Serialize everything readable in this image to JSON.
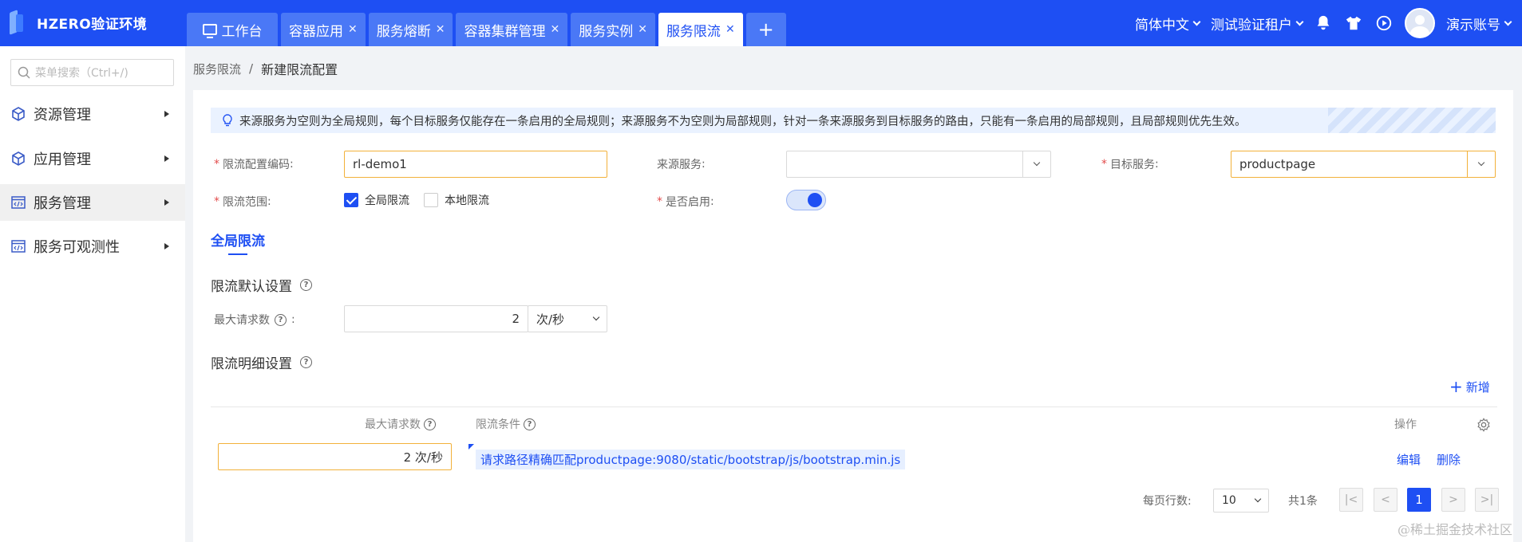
{
  "app": {
    "title": "HZERO验证环境"
  },
  "tabs": [
    {
      "label": "工作台",
      "closable": false
    },
    {
      "label": "容器应用",
      "closable": true
    },
    {
      "label": "服务熔断",
      "closable": true
    },
    {
      "label": "容器集群管理",
      "closable": true
    },
    {
      "label": "服务实例",
      "closable": true
    },
    {
      "label": "服务限流",
      "closable": true,
      "active": true
    }
  ],
  "topbar": {
    "language": "简体中文",
    "tenant": "测试验证租户",
    "account": "演示账号"
  },
  "sidebar": {
    "search_placeholder": "菜单搜索（Ctrl+/)",
    "items": [
      {
        "label": "资源管理",
        "icon": "cube-icon"
      },
      {
        "label": "应用管理",
        "icon": "cube-icon"
      },
      {
        "label": "服务管理",
        "icon": "code-window-icon",
        "active": true
      },
      {
        "label": "服务可观测性",
        "icon": "code-window-icon"
      }
    ]
  },
  "breadcrumb": {
    "parent": "服务限流",
    "separator": "/",
    "current": "新建限流配置"
  },
  "info_text": "来源服务为空则为全局规则，每个目标服务仅能存在一条启用的全局规则；来源服务不为空则为局部规则，针对一条来源服务到目标服务的路由，只能有一条启用的局部规则，且局部规则优先生效。",
  "form": {
    "code_label": "限流配置编码",
    "code_value": "rl-demo1",
    "source_label": "来源服务",
    "source_value": "",
    "target_label": "目标服务",
    "target_value": "productpage",
    "scope_label": "限流范围",
    "scope_options": [
      {
        "label": "全局限流",
        "checked": true
      },
      {
        "label": "本地限流",
        "checked": false
      }
    ],
    "enabled_label": "是否启用",
    "enabled": true,
    "colon": ":"
  },
  "subtab": "全局限流",
  "default_section": {
    "title": "限流默认设置",
    "max_label": "最大请求数",
    "max_value": "2",
    "unit": "次/秒"
  },
  "detail_section": {
    "title": "限流明细设置",
    "add_label": "新增",
    "columns": {
      "max": "最大请求数",
      "cond": "限流条件",
      "op": "操作"
    },
    "rows": [
      {
        "max": "2 次/秒",
        "cond": "请求路径精确匹配productpage:9080/static/bootstrap/js/bootstrap.min.js",
        "edit": "编辑",
        "delete": "删除"
      }
    ]
  },
  "pagination": {
    "rows_label": "每页行数:",
    "page_size": "10",
    "total": "共1条",
    "current_page": "1"
  },
  "watermark": "@稀土掘金技术社区"
}
